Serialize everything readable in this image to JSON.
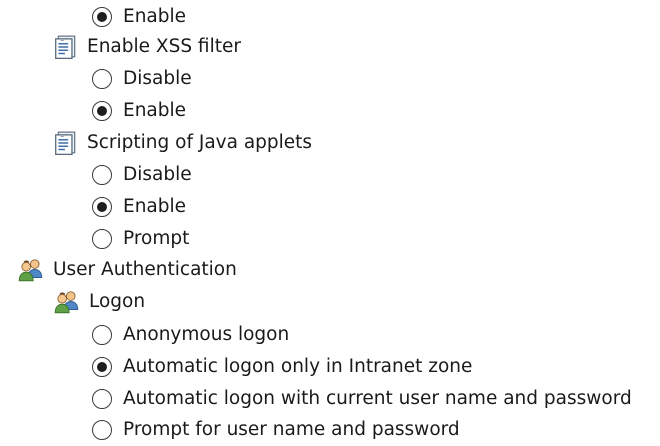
{
  "tree": {
    "top_option": {
      "label": "Enable",
      "checked": true
    },
    "xss_filter": {
      "label": "Enable XSS filter",
      "icon": "script-settings-icon",
      "options": [
        {
          "label": "Disable",
          "checked": false
        },
        {
          "label": "Enable",
          "checked": true
        }
      ]
    },
    "java_scripting": {
      "label": "Scripting of Java applets",
      "icon": "script-settings-icon",
      "options": [
        {
          "label": "Disable",
          "checked": false
        },
        {
          "label": "Enable",
          "checked": true
        },
        {
          "label": "Prompt",
          "checked": false
        }
      ]
    },
    "user_auth": {
      "label": "User Authentication",
      "icon": "users-icon",
      "logon": {
        "label": "Logon",
        "icon": "users-icon",
        "options": [
          {
            "label": "Anonymous logon",
            "checked": false
          },
          {
            "label": "Automatic logon only in Intranet zone",
            "checked": true
          },
          {
            "label": "Automatic logon with current user name and password",
            "checked": false
          },
          {
            "label": "Prompt for user name and password",
            "checked": false
          }
        ]
      }
    }
  }
}
